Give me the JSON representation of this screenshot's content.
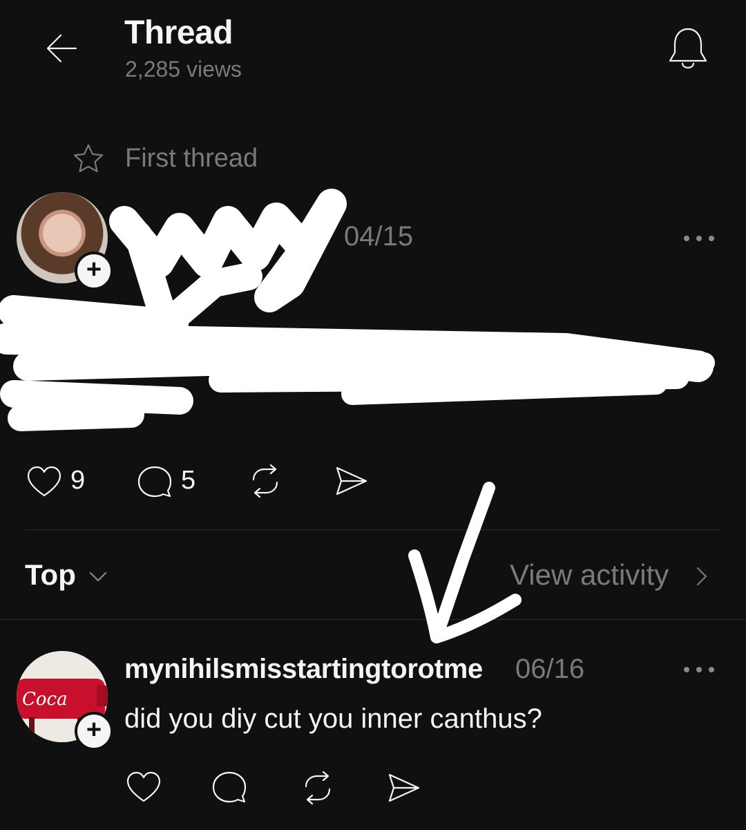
{
  "header": {
    "title": "Thread",
    "views": "2,285 views",
    "icons": [
      "back-arrow-icon",
      "bell-icon"
    ]
  },
  "thread_tag": {
    "label": "First thread",
    "icon": "star-icon"
  },
  "post": {
    "date": "04/15",
    "likes": "9",
    "replies": "5",
    "icons": [
      "heart-icon",
      "comment-icon",
      "repost-icon",
      "share-icon",
      "more-icon"
    ]
  },
  "sort": {
    "label": "Top",
    "view_activity": "View activity"
  },
  "reply": {
    "username": "mynihilsmisstartingtorotme",
    "date": "06/16",
    "text": "did you diy cut you inner canthus?"
  },
  "colors": {
    "background": "#101010",
    "text": "#f3f5f7",
    "muted": "#7a7a7a",
    "divider": "#2b2b2b"
  }
}
